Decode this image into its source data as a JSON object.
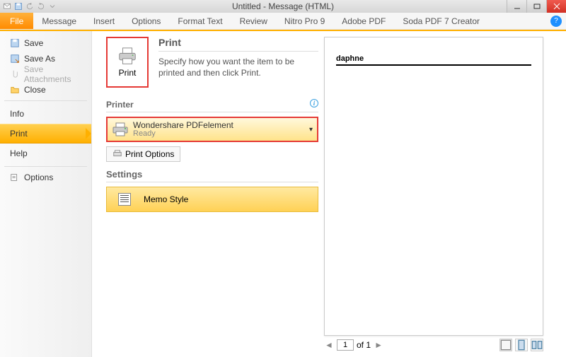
{
  "window": {
    "title": "Untitled - Message (HTML)"
  },
  "ribbon": {
    "file": "File",
    "tabs": [
      "Message",
      "Insert",
      "Options",
      "Format Text",
      "Review",
      "Nitro Pro 9",
      "Adobe PDF",
      "Soda PDF 7 Creator"
    ]
  },
  "sidebar": {
    "save": "Save",
    "save_as": "Save As",
    "save_attachments": "Save Attachments",
    "close": "Close",
    "info": "Info",
    "print": "Print",
    "help": "Help",
    "options": "Options"
  },
  "print": {
    "button_label": "Print",
    "heading": "Print",
    "description": "Specify how you want the item to be printed and then click Print."
  },
  "printer": {
    "section": "Printer",
    "name": "Wondershare PDFelement",
    "status": "Ready",
    "options_button": "Print Options"
  },
  "settings": {
    "section": "Settings",
    "style": "Memo Style"
  },
  "preview": {
    "header_text": "daphne",
    "page_current": "1",
    "page_label": "of 1"
  }
}
